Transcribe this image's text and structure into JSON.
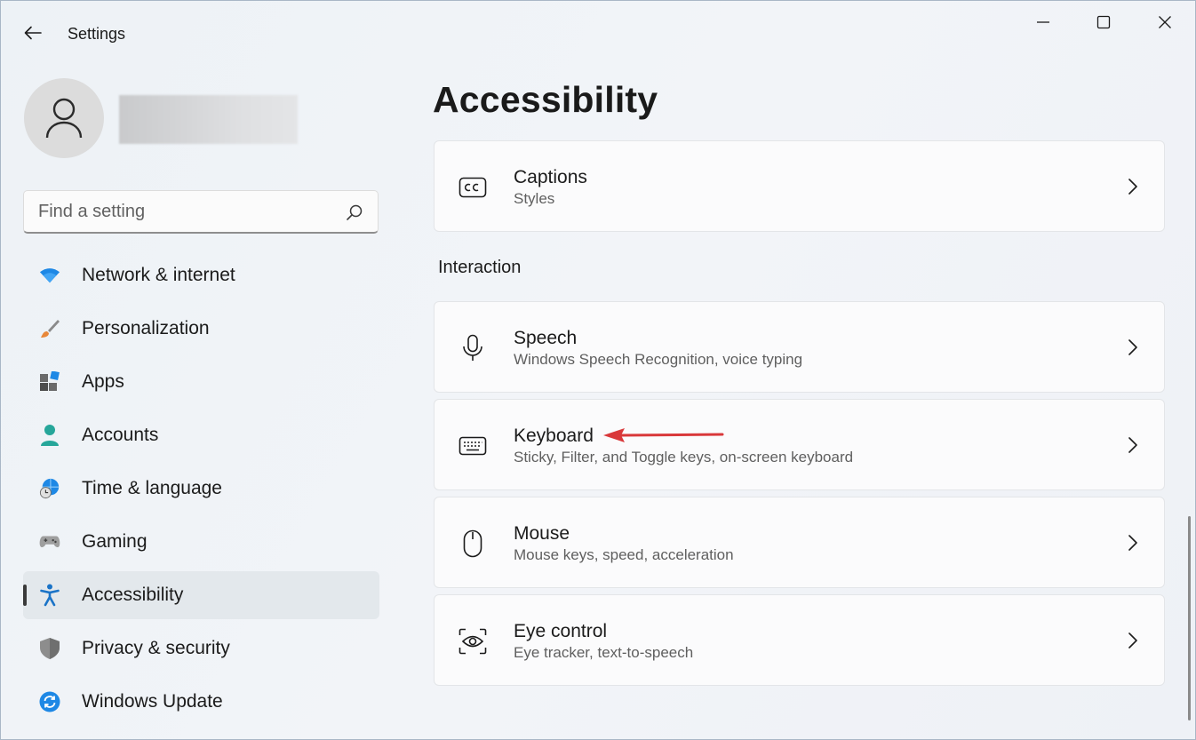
{
  "window": {
    "title": "Settings"
  },
  "profile": {
    "avatar_icon": "person-icon"
  },
  "search": {
    "placeholder": "Find a setting",
    "value": "",
    "icon": "search-icon"
  },
  "sidebar": {
    "items": [
      {
        "label": "Network & internet",
        "icon": "wifi-icon"
      },
      {
        "label": "Personalization",
        "icon": "brush-icon"
      },
      {
        "label": "Apps",
        "icon": "apps-icon"
      },
      {
        "label": "Accounts",
        "icon": "person-icon"
      },
      {
        "label": "Time & language",
        "icon": "globe-clock-icon"
      },
      {
        "label": "Gaming",
        "icon": "gamepad-icon"
      },
      {
        "label": "Accessibility",
        "icon": "accessibility-icon",
        "active": true
      },
      {
        "label": "Privacy & security",
        "icon": "shield-icon"
      },
      {
        "label": "Windows Update",
        "icon": "update-icon"
      }
    ]
  },
  "main": {
    "title": "Accessibility",
    "captions": {
      "title": "Captions",
      "subtitle": "Styles",
      "icon": "cc-icon"
    },
    "section_interaction": "Interaction",
    "speech": {
      "title": "Speech",
      "subtitle": "Windows Speech Recognition, voice typing",
      "icon": "microphone-icon"
    },
    "keyboard": {
      "title": "Keyboard",
      "subtitle": "Sticky, Filter, and Toggle keys, on-screen keyboard",
      "icon": "keyboard-icon"
    },
    "mouse": {
      "title": "Mouse",
      "subtitle": "Mouse keys, speed, acceleration",
      "icon": "mouse-icon"
    },
    "eye_control": {
      "title": "Eye control",
      "subtitle": "Eye tracker, text-to-speech",
      "icon": "eye-control-icon"
    }
  },
  "colors": {
    "accent": "#0067c0",
    "annotation_arrow": "#d9383a"
  }
}
